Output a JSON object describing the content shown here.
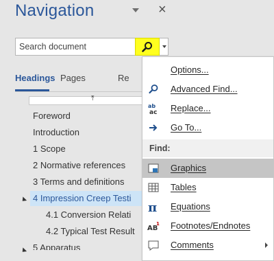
{
  "pane": {
    "title": "Navigation",
    "search_placeholder": "Search document",
    "tabs": [
      {
        "label": "Headings"
      },
      {
        "label": "Pages"
      },
      {
        "label": "Re"
      }
    ],
    "collapse_symbol": "⤒",
    "headings": [
      {
        "label": "Foreword"
      },
      {
        "label": "Introduction"
      },
      {
        "label": "1 Scope"
      },
      {
        "label": "2 Normative references"
      },
      {
        "label": "3 Terms and definitions"
      },
      {
        "label": "4 Impression Creep Testi"
      },
      {
        "label": "4.1 Conversion Relati"
      },
      {
        "label": "4.2 Typical Test Result"
      },
      {
        "label": "5 Apparatus"
      }
    ]
  },
  "menu": {
    "items_top": [
      {
        "label": "Options...",
        "icon": "none"
      },
      {
        "label": "Advanced Find...",
        "icon": "search-icon"
      },
      {
        "label": "Replace...",
        "icon": "replace-icon"
      },
      {
        "label": "Go To...",
        "icon": "arrow-right-icon"
      }
    ],
    "find_header": "Find:",
    "items_find": [
      {
        "label": "Graphics",
        "icon": "graphics-icon"
      },
      {
        "label": "Tables",
        "icon": "table-icon"
      },
      {
        "label": "Equations",
        "icon": "pi-icon"
      },
      {
        "label": "Footnotes/Endnotes",
        "icon": "footnote-icon"
      },
      {
        "label": "Comments",
        "icon": "comment-icon"
      }
    ]
  },
  "colors": {
    "accent": "#2b579a",
    "search_button": "#ffff1f",
    "menu_highlight": "#c5c5c5"
  }
}
